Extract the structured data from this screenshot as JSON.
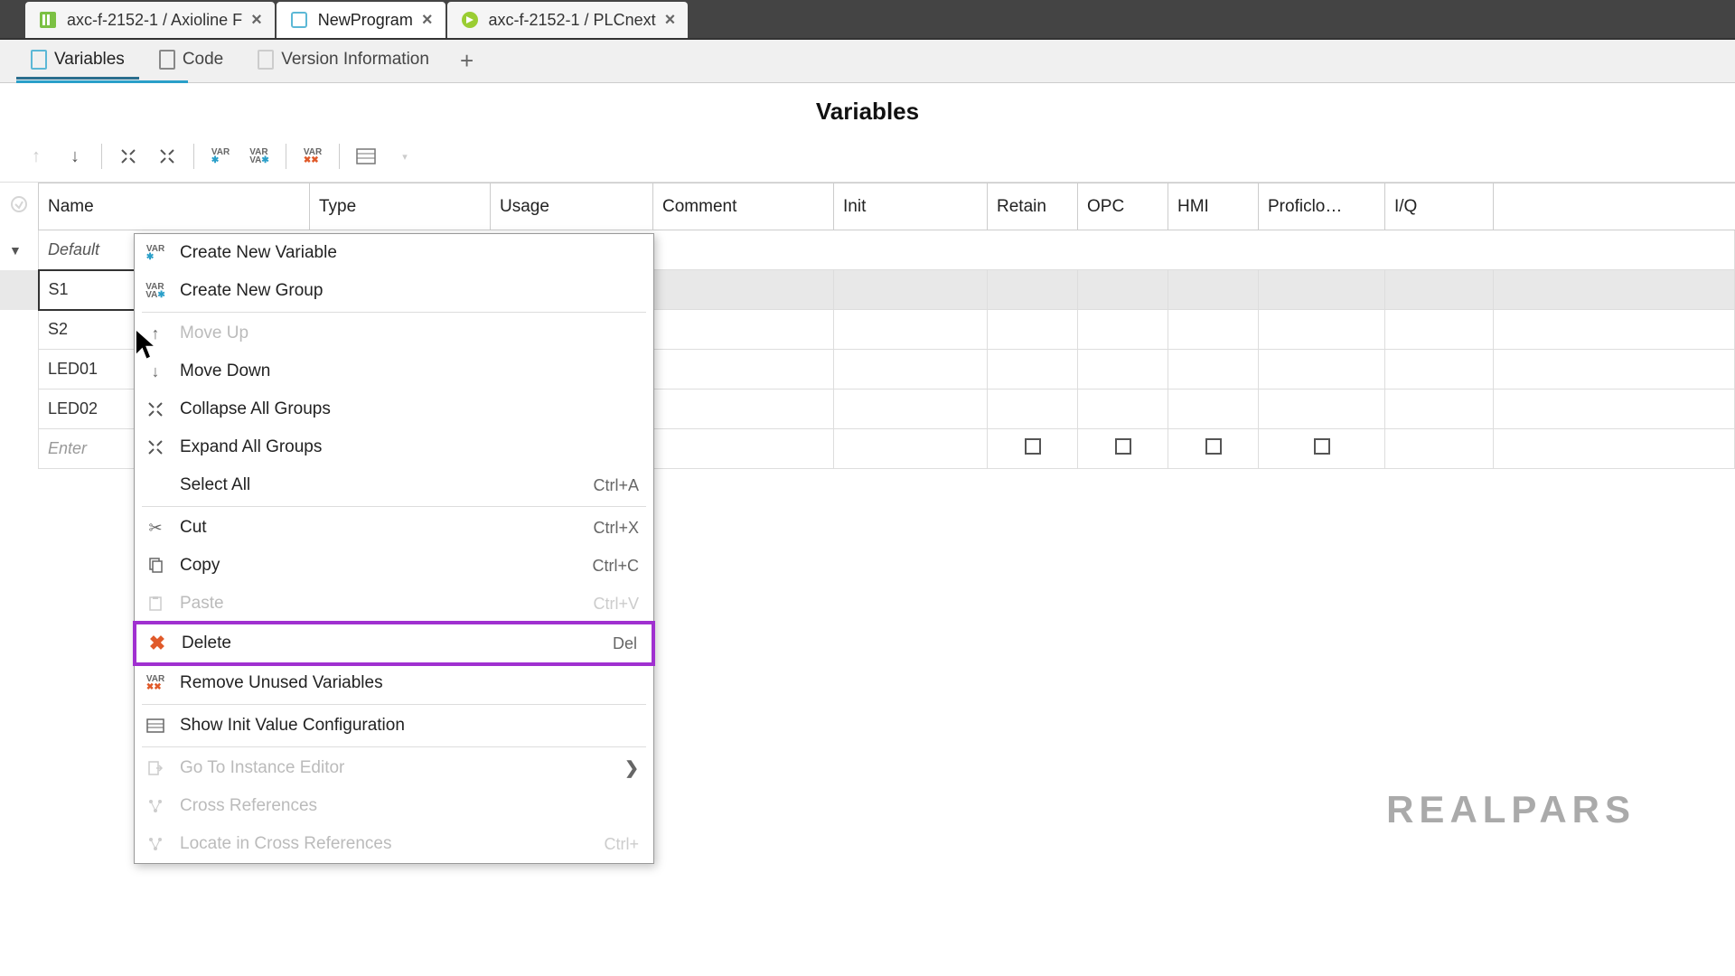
{
  "tabs": [
    {
      "label": "axc-f-2152-1 / Axioline F",
      "active": false,
      "icon": "axio"
    },
    {
      "label": "NewProgram",
      "active": true,
      "icon": "program"
    },
    {
      "label": "axc-f-2152-1 / PLCnext",
      "active": false,
      "icon": "plc"
    }
  ],
  "subtabs": [
    {
      "label": "Variables",
      "active": true
    },
    {
      "label": "Code",
      "active": false
    },
    {
      "label": "Version Information",
      "active": false
    }
  ],
  "section_title": "Variables",
  "columns": [
    "Name",
    "Type",
    "Usage",
    "Comment",
    "Init",
    "Retain",
    "OPC",
    "HMI",
    "Proficlo…",
    "I/Q"
  ],
  "group": "Default",
  "rows": [
    {
      "name": "S1",
      "selected": true
    },
    {
      "name": "S2"
    },
    {
      "name": "LED01"
    },
    {
      "name": "LED02"
    }
  ],
  "enter_placeholder": "Enter",
  "context_menu": {
    "items": [
      {
        "icon": "var-new",
        "label": "Create New Variable",
        "enabled": true
      },
      {
        "icon": "var-group",
        "label": "Create New Group",
        "enabled": true
      },
      {
        "sep": true
      },
      {
        "icon": "arrow-up",
        "label": "Move Up",
        "enabled": false
      },
      {
        "icon": "arrow-down",
        "label": "Move Down",
        "enabled": true
      },
      {
        "icon": "collapse",
        "label": "Collapse All Groups",
        "enabled": true
      },
      {
        "icon": "expand",
        "label": "Expand All Groups",
        "enabled": true
      },
      {
        "icon": "",
        "label": "Select All",
        "shortcut": "Ctrl+A",
        "enabled": true
      },
      {
        "sep": true
      },
      {
        "icon": "cut",
        "label": "Cut",
        "shortcut": "Ctrl+X",
        "enabled": true
      },
      {
        "icon": "copy",
        "label": "Copy",
        "shortcut": "Ctrl+C",
        "enabled": true
      },
      {
        "icon": "paste",
        "label": "Paste",
        "shortcut": "Ctrl+V",
        "enabled": false
      },
      {
        "icon": "delete",
        "label": "Delete",
        "shortcut": "Del",
        "enabled": true,
        "highlight": true
      },
      {
        "icon": "var-remove",
        "label": "Remove Unused Variables",
        "enabled": true
      },
      {
        "sep": true
      },
      {
        "icon": "init",
        "label": "Show Init Value Configuration",
        "enabled": true
      },
      {
        "sep": true
      },
      {
        "icon": "goto",
        "label": "Go To Instance Editor",
        "submenu": true,
        "enabled": false
      },
      {
        "icon": "xref",
        "label": "Cross References",
        "enabled": false
      },
      {
        "icon": "locate",
        "label": "Locate in Cross References",
        "shortcut": "Ctrl+",
        "enabled": false
      }
    ]
  },
  "watermark": "REALPARS"
}
